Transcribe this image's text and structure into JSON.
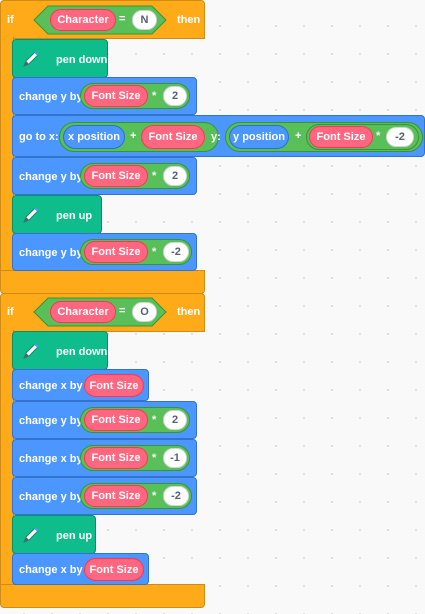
{
  "colors": {
    "control": "#ffab19",
    "motion": "#4c97ff",
    "pen": "#0fbd8c",
    "variable": "#ff6680",
    "operator": "#59c059"
  },
  "script": {
    "if1": {
      "if_label": "if",
      "then_label": "then",
      "condition_variable": "Character",
      "condition_operator": "=",
      "condition_value": "N",
      "body": {
        "pen_down": "pen down",
        "change_y_1": {
          "label": "change y by",
          "variable": "Font Size",
          "operator": "*",
          "value": "2"
        },
        "goto": {
          "label": "go to x:",
          "x_reporter": "x position",
          "x_plus": "+",
          "x_variable": "Font Size",
          "y_label": "y:",
          "y_reporter": "y position",
          "y_plus": "+",
          "y_variable": "Font Size",
          "y_operator": "*",
          "y_value": "-2"
        },
        "change_y_2": {
          "label": "change y by",
          "variable": "Font Size",
          "operator": "*",
          "value": "2"
        },
        "pen_up": "pen up",
        "change_y_3": {
          "label": "change y by",
          "variable": "Font Size",
          "operator": "*",
          "value": "-2"
        }
      }
    },
    "if2": {
      "if_label": "if",
      "then_label": "then",
      "condition_variable": "Character",
      "condition_operator": "=",
      "condition_value": "O",
      "body": {
        "pen_down": "pen down",
        "change_x_1": {
          "label": "change x by",
          "variable": "Font Size"
        },
        "change_y_1": {
          "label": "change y by",
          "variable": "Font Size",
          "operator": "*",
          "value": "2"
        },
        "change_x_2": {
          "label": "change x by",
          "variable": "Font Size",
          "operator": "*",
          "value": "-1"
        },
        "change_y_2": {
          "label": "change y by",
          "variable": "Font Size",
          "operator": "*",
          "value": "-2"
        },
        "pen_up": "pen up",
        "change_x_3": {
          "label": "change x by",
          "variable": "Font Size"
        }
      }
    }
  }
}
